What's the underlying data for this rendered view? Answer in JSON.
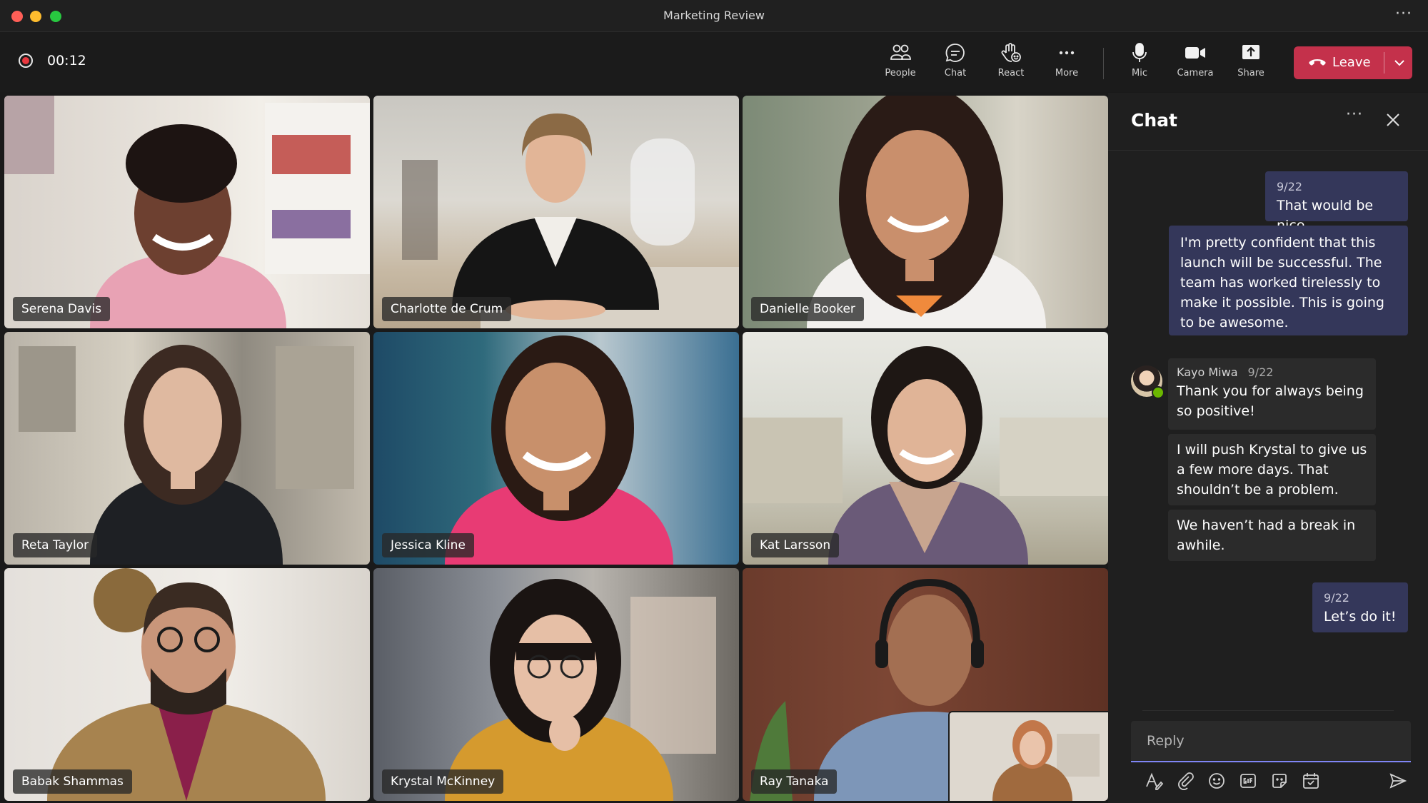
{
  "window": {
    "title": "Marketing Review",
    "more_glyph": "···"
  },
  "recording": {
    "timer": "00:12"
  },
  "toolbar": {
    "people": "People",
    "chat": "Chat",
    "react": "React",
    "more": "More",
    "mic": "Mic",
    "camera": "Camera",
    "share": "Share",
    "leave": "Leave"
  },
  "participants": [
    {
      "name": "Serena Davis"
    },
    {
      "name": "Charlotte de Crum"
    },
    {
      "name": "Danielle Booker"
    },
    {
      "name": "Reta Taylor"
    },
    {
      "name": "Jessica Kline"
    },
    {
      "name": "Kat Larsson"
    },
    {
      "name": "Babak Shammas"
    },
    {
      "name": "Krystal McKinney"
    },
    {
      "name": "Ray Tanaka"
    }
  ],
  "chat": {
    "title": "Chat",
    "more_glyph": "···",
    "messages": [
      {
        "date": "9/22",
        "text": "That would be nice"
      },
      {
        "text": "I'm pretty confident that this launch will be successful. The team has worked tirelessly to make it possible. This is going to be awesome."
      },
      {
        "sender": "Kayo Miwa",
        "date": "9/22",
        "text": "Thank you for always being so positive!"
      },
      {
        "text": "I will push Krystal to give us a few more days. That shouldn’t be a problem."
      },
      {
        "text": "We haven’t had a break in awhile."
      },
      {
        "date": "9/22",
        "text": "Let’s do it!"
      }
    ],
    "reply_placeholder": "Reply"
  }
}
